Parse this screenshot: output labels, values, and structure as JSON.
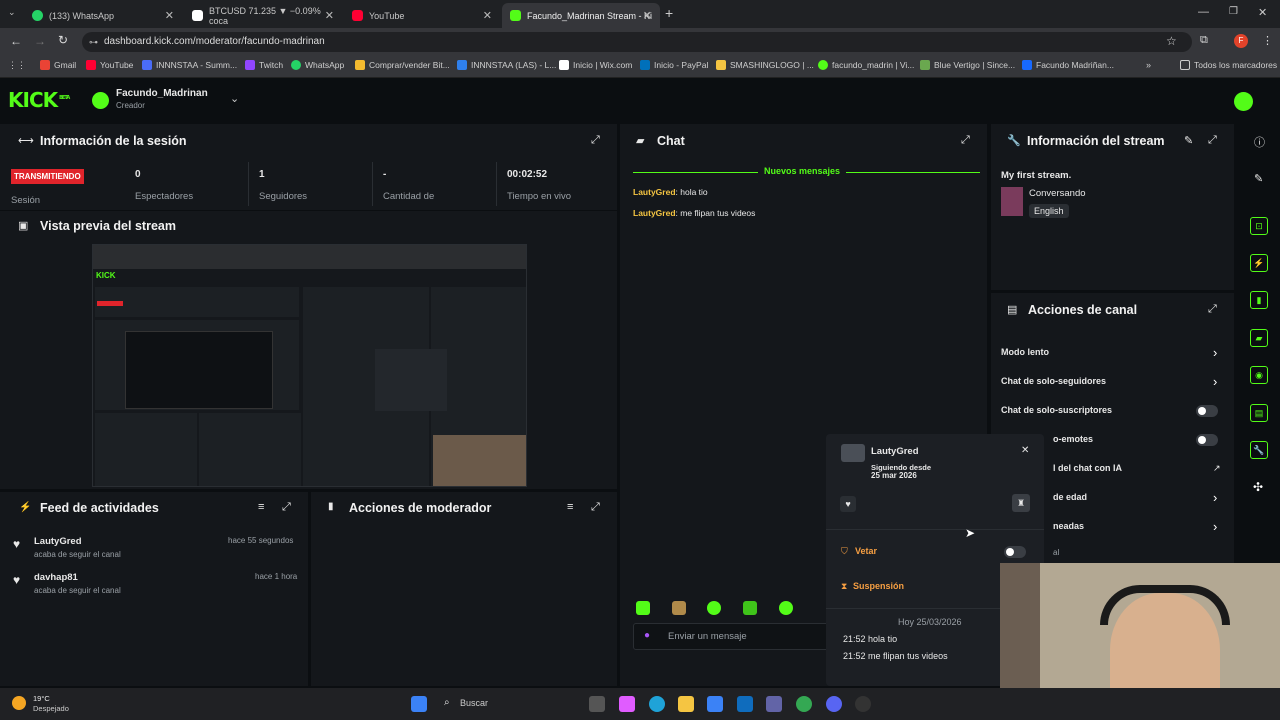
{
  "browser": {
    "tabs": [
      {
        "label": "(133) WhatsApp",
        "color": "#25d366"
      },
      {
        "label": "BTCUSD 71.235 ▼ −0.09% coca",
        "color": "#ffffff"
      },
      {
        "label": "YouTube",
        "color": "#ff0033"
      },
      {
        "label": "Facundo_Madrinan Stream - Ki",
        "color": "#53fc18"
      }
    ],
    "url": "dashboard.kick.com/moderator/facundo-madrinan",
    "bookmarks": [
      "Gmail",
      "YouTube",
      "INNNSTAA - Summ...",
      "Twitch",
      "WhatsApp",
      "Comprar/vender Bit...",
      "INNNSTAA (LAS) - L...",
      "Inicio | Wix.com",
      "Inicio - PayPal",
      "SMASHINGLOGO | ...",
      "facundo_madrin | Vi...",
      "Blue Vertigo | Since...",
      "Facundo Madriñan..."
    ],
    "bookmarks_folder": "Todos los marcadores",
    "profile_initial": "F"
  },
  "header": {
    "logo": "KICK",
    "logo_tag": "BETA",
    "channel_name": "Facundo_Madrinan",
    "channel_role": "Creador"
  },
  "session": {
    "title": "Información de la sesión",
    "live_badge": "TRANSMITIENDO",
    "session_label": "Sesión",
    "stats": [
      {
        "value": "0",
        "label": "Espectadores"
      },
      {
        "value": "1",
        "label": "Seguidores"
      },
      {
        "value": "-",
        "label": "Cantidad de"
      },
      {
        "value": "00:02:52",
        "label": "Tiempo en vivo"
      }
    ]
  },
  "preview": {
    "title": "Vista previa del stream"
  },
  "feed": {
    "title": "Feed de actividades",
    "items": [
      {
        "user": "LautyGred",
        "action": "acaba de seguir el canal",
        "time": "hace 55 segundos"
      },
      {
        "user": "davhap81",
        "action": "acaba de seguir el canal",
        "time": "hace 1 hora"
      }
    ]
  },
  "mod_actions": {
    "title": "Acciones de moderador"
  },
  "chat": {
    "title": "Chat",
    "new_messages": "Nuevos mensajes",
    "messages": [
      {
        "user": "LautyGred",
        "text": "hola tio"
      },
      {
        "user": "LautyGred",
        "text": "me flipan tus videos"
      }
    ],
    "input_placeholder": "Enviar un mensaje"
  },
  "stream_info": {
    "title": "Información del stream",
    "stream_title": "My first stream.",
    "category": "Conversando",
    "language": "English"
  },
  "channel_actions": {
    "title": "Acciones de canal",
    "items": [
      {
        "label": "Modo lento",
        "control": "chevron"
      },
      {
        "label": "Chat de solo-seguidores",
        "control": "chevron"
      },
      {
        "label": "Chat de solo-suscriptores",
        "control": "toggle"
      },
      {
        "label": "o-emotes",
        "control": "toggle"
      },
      {
        "label": "l del chat con IA",
        "control": "external"
      },
      {
        "label": "de edad",
        "control": "chevron"
      },
      {
        "label": "neadas",
        "control": "chevron"
      },
      {
        "label": "al",
        "control": "none"
      }
    ]
  },
  "user_card": {
    "username": "LautyGred",
    "following_label": "Siguiendo desde",
    "following_date": "25 mar 2026",
    "ban_label": "Vetar",
    "timeout_label": "Suspensión",
    "history_date": "Hoy 25/03/2026",
    "history": [
      {
        "time": "21:52",
        "text": "hola tio"
      },
      {
        "time": "21:52",
        "text": "me flipan tus videos"
      }
    ]
  },
  "taskbar": {
    "weather_temp": "19°C",
    "weather_desc": "Despejado",
    "search_placeholder": "Buscar"
  },
  "colors": {
    "accent": "#53fc18",
    "live_red": "#e0242b",
    "username_gold": "#f5c542",
    "panel_bg": "#14171b",
    "page_bg": "#0b0e11"
  }
}
